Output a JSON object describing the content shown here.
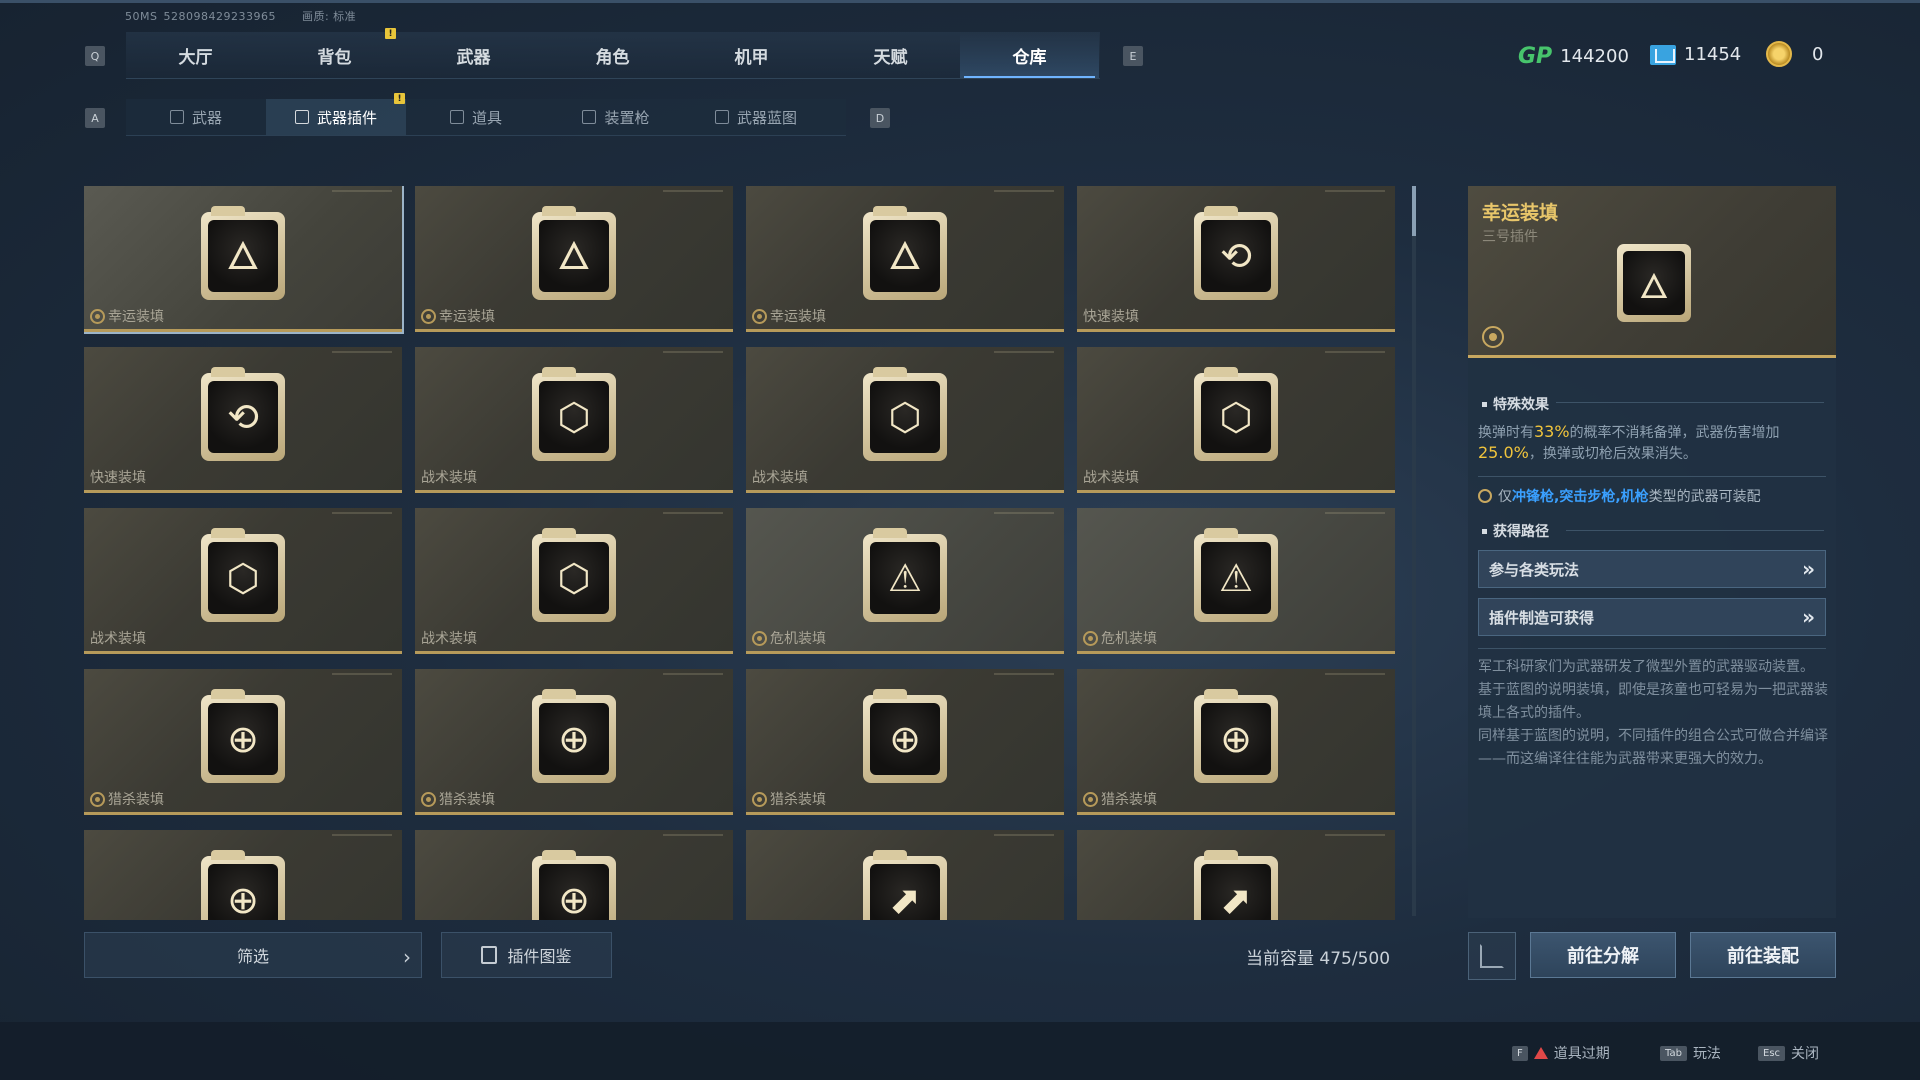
{
  "sysinfo": {
    "ping": "50MS",
    "uid": "528098429233965",
    "quality": "画质: 标准"
  },
  "keys": {
    "prev_main": "Q",
    "next_main": "E",
    "prev_sub": "A",
    "next_sub": "D"
  },
  "main_tabs": [
    {
      "label": "大厅"
    },
    {
      "label": "背包"
    },
    {
      "label": "武器"
    },
    {
      "label": "角色"
    },
    {
      "label": "机甲"
    },
    {
      "label": "天赋"
    },
    {
      "label": "仓库"
    }
  ],
  "sub_tabs": [
    {
      "label": "武器",
      "icon": "gun-icon"
    },
    {
      "label": "武器插件",
      "icon": "chip-icon"
    },
    {
      "label": "道具",
      "icon": "item-icon"
    },
    {
      "label": "装置枪",
      "icon": "device-gun-icon"
    },
    {
      "label": "武器蓝图",
      "icon": "blueprint-icon"
    }
  ],
  "notice_mark": "!",
  "currencies": {
    "gp_label": "GP",
    "gp": "144200",
    "ticket": "11454",
    "coin": "0"
  },
  "cards": [
    {
      "label": "幸运装填",
      "glyph": "🜂",
      "gear": true
    },
    {
      "label": "幸运装填",
      "glyph": "🜂",
      "gear": true
    },
    {
      "label": "幸运装填",
      "glyph": "🜂",
      "gear": true
    },
    {
      "label": "快速装填",
      "glyph": "⟲",
      "gear": false
    },
    {
      "label": "快速装填",
      "glyph": "⟲",
      "gear": false
    },
    {
      "label": "战术装填",
      "glyph": "⬡",
      "gear": false
    },
    {
      "label": "战术装填",
      "glyph": "⬡",
      "gear": false
    },
    {
      "label": "战术装填",
      "glyph": "⬡",
      "gear": false
    },
    {
      "label": "战术装填",
      "glyph": "⬡",
      "gear": false
    },
    {
      "label": "战术装填",
      "glyph": "⬡",
      "gear": false
    },
    {
      "label": "危机装填",
      "glyph": "⚠",
      "gear": true
    },
    {
      "label": "危机装填",
      "glyph": "⚠",
      "gear": true
    },
    {
      "label": "猎杀装填",
      "glyph": "⊕",
      "gear": true
    },
    {
      "label": "猎杀装填",
      "glyph": "⊕",
      "gear": true
    },
    {
      "label": "猎杀装填",
      "glyph": "⊕",
      "gear": true
    },
    {
      "label": "猎杀装填",
      "glyph": "⊕",
      "gear": true
    },
    {
      "label": "",
      "glyph": "⊕",
      "gear": false
    },
    {
      "label": "",
      "glyph": "⊕",
      "gear": false
    },
    {
      "label": "",
      "glyph": "⬈",
      "gear": false
    },
    {
      "label": "",
      "glyph": "⬈",
      "gear": false
    }
  ],
  "bottom": {
    "filter": "筛选",
    "codex": "插件图鉴",
    "capacity": "当前容量 475/500"
  },
  "detail": {
    "name": "幸运装填",
    "subtitle": "三号插件",
    "glyph": "🜂",
    "effect_title": "特殊效果",
    "effect_pre": "换弹时有",
    "effect_pct1": "33%",
    "effect_mid": "的概率不消耗备弹，武器伤害增加",
    "effect_pct2": "25.0%",
    "effect_post": "，换弹或切枪后效果消失。",
    "restrict_pre": "仅",
    "restrict_weapons": "冲锋枪,突击步枪,机枪",
    "restrict_post": "类型的武器可装配",
    "source_title": "获得路径",
    "sources": [
      "参与各类玩法",
      "插件制造可获得"
    ],
    "lore": "军工科研家们为武器研发了微型外置的武器驱动装置。\n基于蓝图的说明装填，即使是孩童也可轻易为一把武器装填上各式的插件。\n同样基于蓝图的说明，不同插件的组合公式可做合并编译——而这编译往往能为武器带来更强大的效力。"
  },
  "actions": {
    "dismantle": "前往分解",
    "equip": "前往装配"
  },
  "hints": [
    {
      "key": "F",
      "label": "道具过期",
      "warn": true
    },
    {
      "key": "Tab",
      "label": "玩法",
      "warn": false
    },
    {
      "key": "Esc",
      "label": "关闭",
      "warn": false
    }
  ]
}
